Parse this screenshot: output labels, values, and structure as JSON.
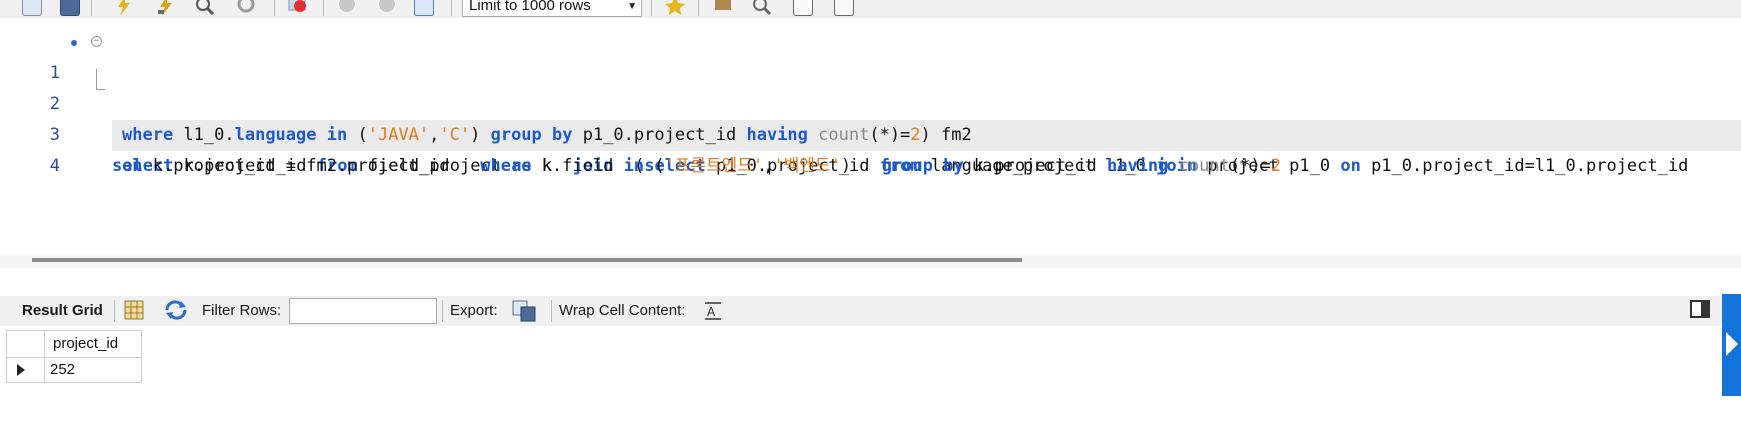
{
  "toolbar": {
    "icons": [
      "new-tab-icon",
      "save-icon",
      "execute-icon",
      "execute-statement-icon",
      "explain-icon",
      "stop-icon",
      "toggle-error-icon",
      "commit-icon",
      "rollback-icon",
      "autocommit-icon",
      "beautify-icon",
      "snippets-icon",
      "find-icon",
      "invisible-chars-icon",
      "word-wrap-icon"
    ],
    "limit_select": "Limit to 1000 rows"
  },
  "editor": {
    "lines": [
      {
        "num": "1"
      },
      {
        "num": "2"
      },
      {
        "num": "3"
      },
      {
        "num": "4"
      }
    ],
    "line1": {
      "t1": "select",
      "t2": " k.project_id ",
      "t3": "from",
      "t4": " field_project ",
      "t5": "as",
      "t6": " k  ",
      "t7": "join",
      "t8": "  (",
      "t9": "select",
      "t10": " p1_0.project_id ",
      "t11": "from",
      "t12": " language_project l1_0 ",
      "t13": "join",
      "t14": " project p1_0 ",
      "t15": "on",
      "t16": " p1_0.project_id=l1_0.project_id"
    },
    "line2": {
      "t1": "where",
      "t2": " l1_0.",
      "t3": "language",
      "t4": " ",
      "t5": "in",
      "t6": " (",
      "t7": "'JAVA'",
      "t8": ",",
      "t9": "'C'",
      "t10": ") ",
      "t11": "group by",
      "t12": " p1_0.project_id ",
      "t13": "having",
      "t14": " ",
      "t15": "count",
      "t16": "(*)=",
      "t17": "2",
      "t18": ") fm2"
    },
    "line3": {
      "t1": "on",
      "t2": " k.project_id = fm2.project_id   ",
      "t3": "where",
      "t4": " k.field ",
      "t5": "in",
      "t6": " (",
      "t7": "'프론트엔드'",
      "t8": ",",
      "t9": "'백엔드'",
      "t10": ")   ",
      "t11": "group by",
      "t12": " k.project_id ",
      "t13": "having",
      "t14": " ",
      "t15": "count",
      "t16": "(*)=",
      "t17": "2"
    }
  },
  "result_toolbar": {
    "result_grid_label": "Result Grid",
    "filter_rows_label": "Filter Rows:",
    "filter_value": "",
    "export_label": "Export:",
    "wrap_label": "Wrap Cell Content:"
  },
  "grid": {
    "columns": [
      "project_id"
    ],
    "rows": [
      [
        "252"
      ]
    ]
  },
  "colors": {
    "keyword": "#1f5ac9",
    "string": "#e07c1c",
    "function": "#8a8a8a",
    "side_tab": "#1473d6"
  }
}
